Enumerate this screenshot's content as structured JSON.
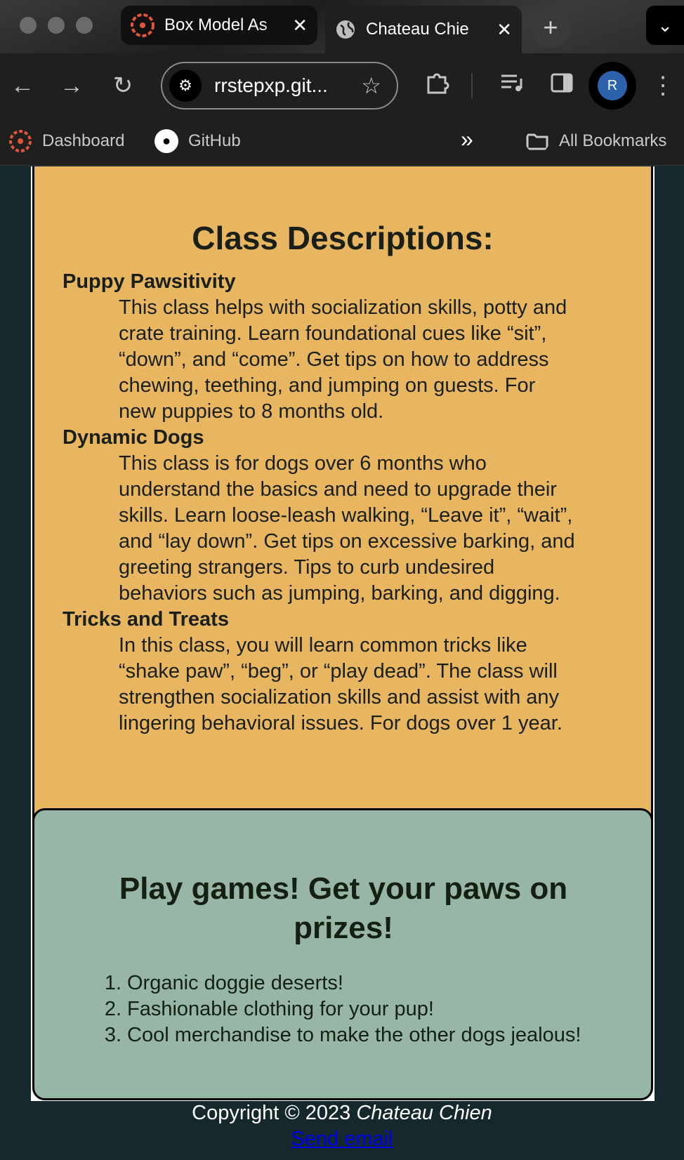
{
  "browser": {
    "tabs": [
      {
        "title": "Box Model As",
        "close": "✕"
      },
      {
        "title": "Chateau Chie",
        "close": "✕"
      }
    ],
    "new_tab": "+",
    "tab_search": "⌄",
    "url": "rrstepxp.git...",
    "avatar_letter": "R",
    "bookmarks": [
      {
        "label": "Dashboard"
      },
      {
        "label": "GitHub"
      }
    ],
    "bookmarks_overflow": "»",
    "all_bookmarks": "All Bookmarks"
  },
  "classes": {
    "title": "Class Descriptions:",
    "items": [
      {
        "name": "Puppy Pawsitivity",
        "lines": [
          "This class helps with socialization skills, potty and",
          "crate training. Learn foundational cues like “sit”,",
          "“down”, and “come”. Get tips on how to address",
          "chewing, teething, and jumping on guests. For",
          "new puppies to 8 months old."
        ]
      },
      {
        "name": "Dynamic Dogs",
        "lines": [
          "This class is for dogs over 6 months who",
          "understand the basics and need to upgrade their",
          "skills. Learn loose-leash walking, “Leave it”, “wait”,",
          "and “lay down”. Get tips on excessive barking, and",
          "greeting strangers. Tips to curb undesired",
          "behaviors such as jumping, barking, and digging."
        ]
      },
      {
        "name": "Tricks and Treats",
        "lines": [
          "In this class, you will learn common tricks like",
          "“shake paw”, “beg”, or “play dead”. The class will",
          "strengthen socialization skills and assist with any",
          "lingering behavioral issues. For dogs over 1 year."
        ]
      }
    ]
  },
  "games": {
    "title_line1": "Play games! Get your paws on",
    "title_line2": "prizes!",
    "prizes": [
      {
        "num": "1.",
        "text": "Organic doggie deserts!"
      },
      {
        "num": "2.",
        "text": "Fashionable clothing for your pup!"
      },
      {
        "num": "3.",
        "text": "Cool merchandise to make the other dogs jealous!"
      }
    ]
  },
  "footer": {
    "copyright": "Copyright © 2023",
    "company": "Chateau Chien",
    "email_link": "Send email"
  },
  "colors": {
    "page_bg": "#15282c",
    "desc_card": "#e8b661",
    "games_card": "#98b6a5",
    "link": "#0000ee"
  }
}
